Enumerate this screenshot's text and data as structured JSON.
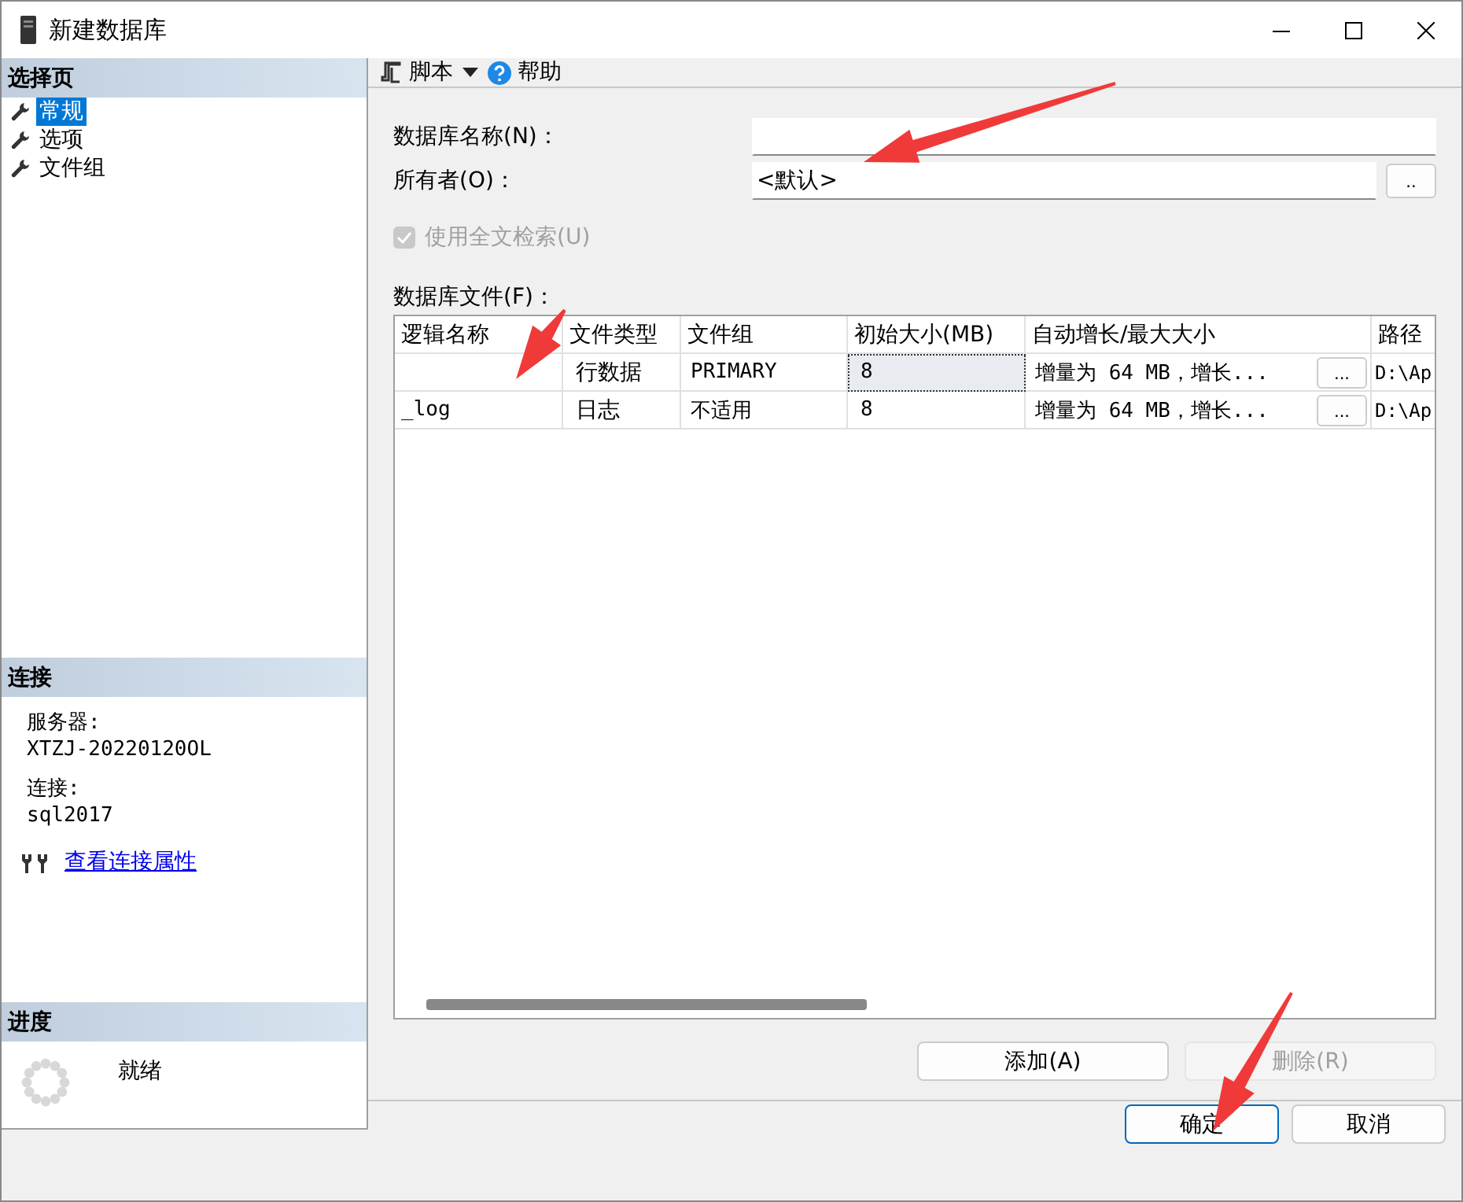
{
  "window": {
    "title": "新建数据库"
  },
  "sidebar": {
    "header": "选择页",
    "items": [
      {
        "label": "常规",
        "selected": true
      },
      {
        "label": "选项",
        "selected": false
      },
      {
        "label": "文件组",
        "selected": false
      }
    ]
  },
  "connection": {
    "header": "连接",
    "server_label": "服务器:",
    "server": "XTZJ-20220120OL",
    "connection_label": "连接:",
    "connection": "sql2017",
    "link": "查看连接属性"
  },
  "progress": {
    "header": "进度",
    "status": "就绪"
  },
  "toolbar": {
    "script": "脚本",
    "help": "帮助"
  },
  "form": {
    "name_label": "数据库名称(N)：",
    "owner_label": "所有者(O)：",
    "owner_value": "<默认>",
    "owner_browse": "..",
    "fulltext": {
      "label": "使用全文检索(U)",
      "checked": true,
      "disabled": true
    },
    "files_label": "数据库文件(F)："
  },
  "table": {
    "columns": [
      "逻辑名称",
      "文件类型",
      "文件组",
      "初始大小(MB)",
      "自动增长/最大大小",
      "路径"
    ],
    "rows": [
      {
        "logical_name": "",
        "file_type": "行数据",
        "filegroup": "PRIMARY",
        "initial_size": "8",
        "size_selected": true,
        "autogrowth": "增量为 64 MB，增长...",
        "browse": "...",
        "path": "D:\\Ap"
      },
      {
        "logical_name": "_log",
        "file_type": "日志",
        "filegroup": "不适用",
        "initial_size": "8",
        "size_selected": false,
        "autogrowth": "增量为 64 MB，增长...",
        "browse": "...",
        "path": "D:\\Ap"
      }
    ]
  },
  "table_buttons": [
    {
      "label": "添加(A)",
      "disabled": false
    },
    {
      "label": "删除(R)",
      "disabled": true
    }
  ],
  "dialog_buttons": [
    {
      "label": "确定",
      "default": true
    },
    {
      "label": "取消",
      "default": false
    }
  ],
  "annotations": [
    {
      "kind": "arrow"
    },
    {
      "kind": "arrow"
    },
    {
      "kind": "arrow"
    }
  ]
}
